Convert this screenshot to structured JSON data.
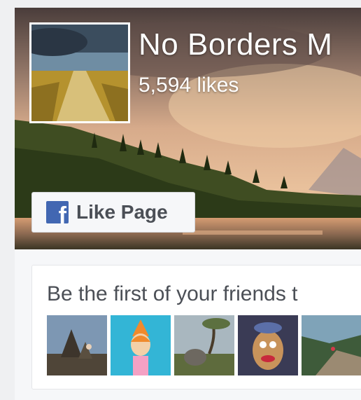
{
  "page": {
    "name": "No Borders M",
    "likes": "5,594 likes"
  },
  "like_button": {
    "label": "Like Page",
    "icon": "facebook-f-icon"
  },
  "friends": {
    "prompt": "Be the first of your friends t",
    "photos": [
      {
        "icon": "temple-photo"
      },
      {
        "icon": "cartoon-girl-photo"
      },
      {
        "icon": "elephant-photo"
      },
      {
        "icon": "toy-potato-head-photo"
      },
      {
        "icon": "coast-cliff-photo"
      }
    ]
  },
  "colors": {
    "facebook_blue": "#4267b2",
    "text_dark": "#4b4f56",
    "background": "#eff0f2"
  }
}
